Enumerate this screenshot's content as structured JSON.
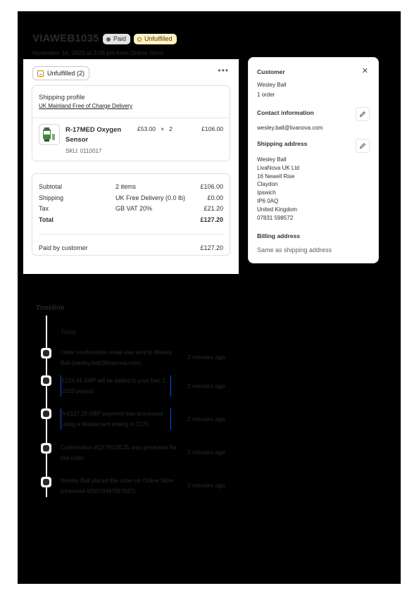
{
  "order": {
    "title": "VIAWEB1035",
    "badges": {
      "paid": "Paid",
      "unfulfilled": "Unfulfilled"
    },
    "subtitle": "November 16, 2023 at 2:26 pm from Online Store"
  },
  "fulfillment": {
    "chip": "Unfulfilled (2)",
    "more": "•••",
    "shipping_profile_label": "Shipping profile",
    "shipping_profile_link": "UK Mainland Free of Charge Delivery",
    "item": {
      "name": "R-17MED Oxygen Sensor",
      "sku": "SKU: 0110017",
      "qty": "£53.00   ×   2",
      "total": "£106.00"
    }
  },
  "summary": {
    "rows": [
      {
        "label": "Subtotal",
        "middle": "2 items",
        "value": "£106.00"
      },
      {
        "label": "Shipping",
        "middle": "UK Free Delivery (0.0 lb)",
        "value": "£0.00"
      },
      {
        "label": "Tax",
        "middle": "GB VAT 20%",
        "value": "£21.20"
      },
      {
        "label": "Total",
        "middle": "",
        "value": "£127.20"
      }
    ],
    "paid_label": "Paid by customer",
    "paid_value": "£127.20"
  },
  "customer": {
    "heading": "Customer",
    "close": "✕",
    "name": "Wesley Ball",
    "orders": "1 order",
    "contact_heading": "Contact information",
    "email": "wesley.ball@livanova.com",
    "shipping_heading": "Shipping address",
    "address": [
      "Wesley Ball",
      "LivaNova UK Ltd",
      "16 Newell Rise",
      "Claydon",
      "Ipswich",
      "IP6 0AQ",
      "United Kingdom",
      "07831 598572"
    ],
    "billing_heading": "Billing address",
    "billing_text": "Same as shipping address"
  },
  "timeline": {
    "title": "Timeline",
    "today": "Today",
    "events": [
      {
        "text": "Order confirmation email was sent to Wesley Ball (wesley.ball@livanova.com).",
        "ago": "2 minutes ago"
      },
      {
        "text": "£124.41 GBP will be added to your Dec 1, 2023 payout.",
        "ago": "2 minutes ago"
      },
      {
        "text": "A £127.20 GBP payment was processed using a Mastercard ending in 7170.",
        "ago": "2 minutes ago"
      },
      {
        "text": "Confirmation #QT7RU3CZL was generated for this order.",
        "ago": "2 minutes ago"
      },
      {
        "text": "Wesley Ball placed this order on Online Store (checkout #25079487057637).",
        "ago": "2 minutes ago"
      }
    ]
  },
  "colors": {
    "paid_badge": "#e3e3e3",
    "unfulfilled_badge": "#fff1c2",
    "accent_blue": "#1d4fbf"
  }
}
